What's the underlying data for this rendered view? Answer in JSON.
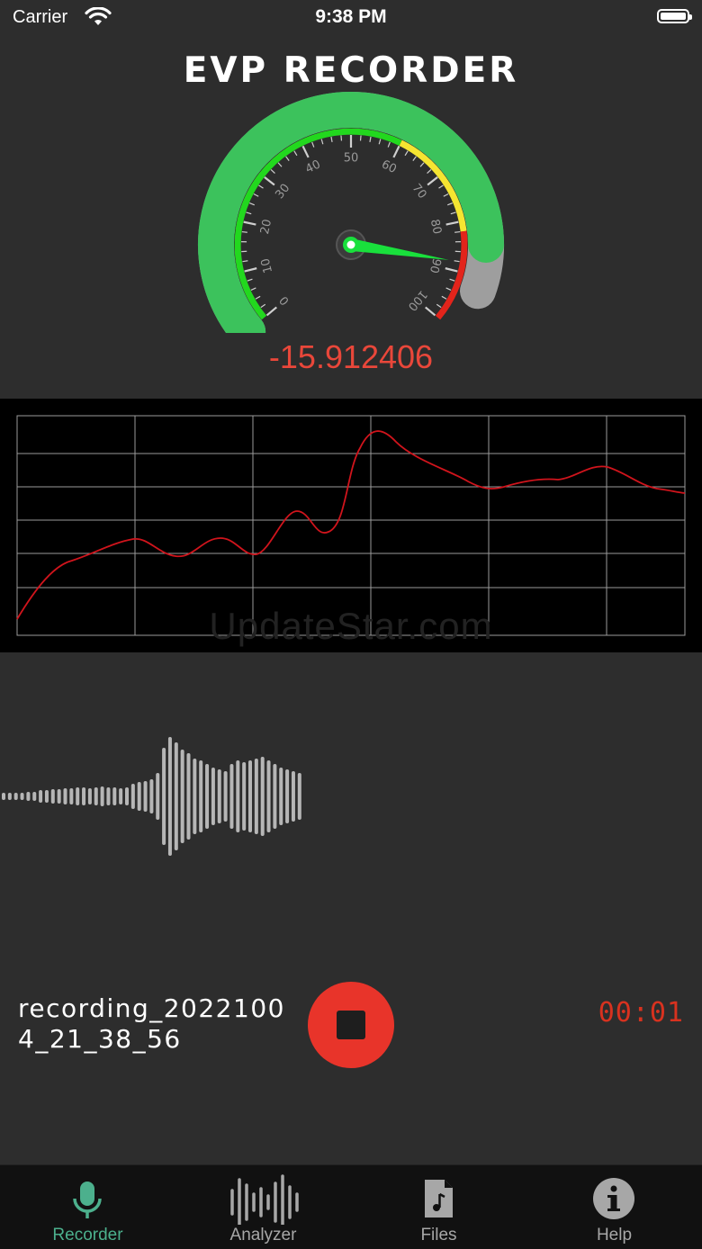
{
  "status_bar": {
    "carrier": "Carrier",
    "time": "9:38 PM"
  },
  "app": {
    "title": "EVP RECORDER"
  },
  "meter": {
    "scale_labels": [
      "0",
      "10",
      "20",
      "30",
      "40",
      "50",
      "60",
      "70",
      "80",
      "90",
      "100"
    ],
    "needle_value": 88,
    "reading": "-15.912406",
    "colors": {
      "green": "#3cc25c",
      "yellow": "#f5e531",
      "red": "#e3241b",
      "grey": "#9e9e9e",
      "needle": "#19e03c"
    }
  },
  "watermark": "UpdateStar.com",
  "recording": {
    "file_name": "recording_20221004_21_38_56",
    "timer": "00:01",
    "stop_color": "#e8342a"
  },
  "tabs": [
    {
      "label": "Recorder",
      "icon": "mic-icon",
      "active": true
    },
    {
      "label": "Analyzer",
      "icon": "waveform-icon",
      "active": false
    },
    {
      "label": "Files",
      "icon": "music-file-icon",
      "active": false
    },
    {
      "label": "Help",
      "icon": "info-icon",
      "active": false
    }
  ]
}
